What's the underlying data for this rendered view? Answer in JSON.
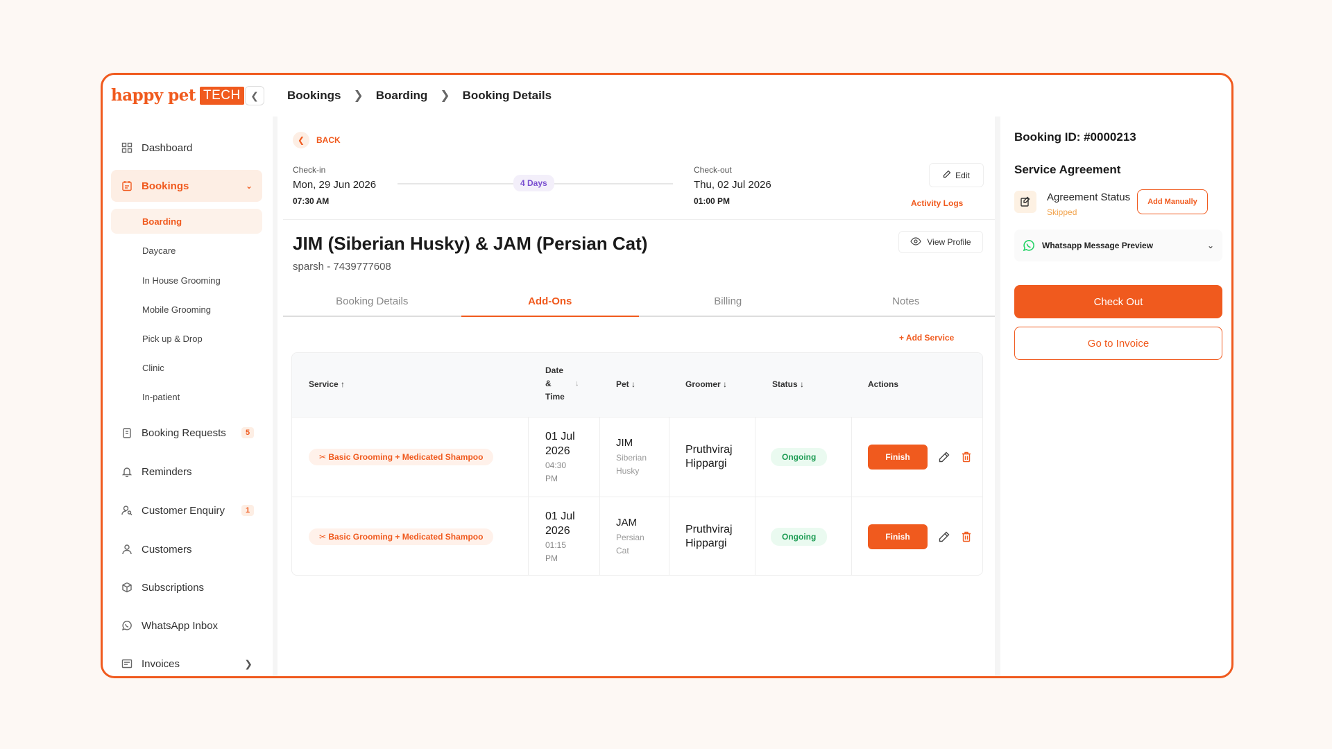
{
  "brand": {
    "name": "happy pet",
    "badge": "TECH",
    "accent": "#f05a1e"
  },
  "breadcrumb": [
    "Bookings",
    "Boarding",
    "Booking Details"
  ],
  "sidebar": {
    "items": [
      {
        "label": "Dashboard",
        "icon": "grid-icon"
      },
      {
        "label": "Bookings",
        "icon": "calendar-icon"
      },
      {
        "label": "Booking Requests",
        "icon": "clipboard-icon",
        "badge": "5"
      },
      {
        "label": "Reminders",
        "icon": "bell-icon"
      },
      {
        "label": "Customer Enquiry",
        "icon": "user-search-icon",
        "badge": "1"
      },
      {
        "label": "Customers",
        "icon": "user-icon"
      },
      {
        "label": "Subscriptions",
        "icon": "box-icon"
      },
      {
        "label": "WhatsApp Inbox",
        "icon": "whatsapp-icon"
      },
      {
        "label": "Invoices",
        "icon": "invoice-icon"
      }
    ],
    "sub_items": [
      "Boarding",
      "Daycare",
      "In House Grooming",
      "Mobile Grooming",
      "Pick up & Drop",
      "Clinic",
      "In-patient"
    ]
  },
  "main": {
    "back_label": "BACK",
    "checkin": {
      "label": "Check-in",
      "date": "Mon, 29 Jun 2026",
      "time": "07:30 AM"
    },
    "checkout": {
      "label": "Check-out",
      "date": "Thu, 02 Jul 2026",
      "time": "01:00 PM"
    },
    "duration": "4 Days",
    "edit_label": "Edit",
    "activity_logs_label": "Activity Logs",
    "pet_title": "JIM (Siberian Husky) & JAM (Persian Cat)",
    "owner_line": "sparsh - 7439777608",
    "view_profile_label": "View Profile",
    "tabs": [
      "Booking Details",
      "Add-Ons",
      "Billing",
      "Notes"
    ],
    "add_service_label": "+ Add Service",
    "table": {
      "headers": {
        "service": "Service ↑",
        "date_l1": "Date",
        "date_l2": "&",
        "date_l3": "Time",
        "pet": "Pet ↓",
        "groomer": "Groomer ↓",
        "status": "Status ↓",
        "actions": "Actions"
      },
      "rows": [
        {
          "service": "✂ Basic Grooming + Medicated Shampoo",
          "date_l1": "01 Jul",
          "date_l2": "2026",
          "time_l1": "04:30",
          "time_l2": "PM",
          "pet": "JIM",
          "breed_l1": "Siberian",
          "breed_l2": "Husky",
          "groomer_l1": "Pruthviraj",
          "groomer_l2": "Hippargi",
          "status": "Ongoing",
          "action": "Finish"
        },
        {
          "service": "✂ Basic Grooming + Medicated Shampoo",
          "date_l1": "01 Jul",
          "date_l2": "2026",
          "time_l1": "01:15",
          "time_l2": "PM",
          "pet": "JAM",
          "breed_l1": "Persian",
          "breed_l2": "Cat",
          "groomer_l1": "Pruthviraj",
          "groomer_l2": "Hippargi",
          "status": "Ongoing",
          "action": "Finish"
        }
      ]
    }
  },
  "right": {
    "booking_id": "Booking ID: #0000213",
    "service_agreement": "Service Agreement",
    "agreement_label": "Agreement Status",
    "agreement_status": "Skipped",
    "add_manually_label": "Add Manually",
    "whatsapp_preview_label": "Whatsapp Message Preview",
    "checkout_label": "Check Out",
    "invoice_label": "Go to Invoice"
  }
}
